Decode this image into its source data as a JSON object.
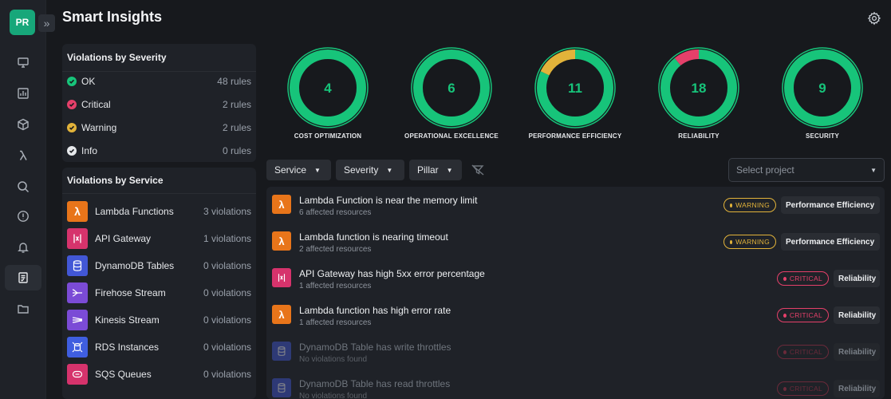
{
  "app": {
    "avatar_initials": "PR",
    "title": "Smart Insights",
    "expand_glyph": "»"
  },
  "nav": [
    {
      "icon": "monitor-icon"
    },
    {
      "icon": "bar-chart-icon"
    },
    {
      "icon": "cube-icon"
    },
    {
      "icon": "lambda-icon"
    },
    {
      "icon": "search-icon"
    },
    {
      "icon": "alert-circle-icon"
    },
    {
      "icon": "bell-icon"
    },
    {
      "icon": "insights-icon",
      "active": true
    },
    {
      "icon": "folder-icon"
    }
  ],
  "severity_panel": {
    "title": "Violations by Severity",
    "rows": [
      {
        "label": "OK",
        "count": "48 rules",
        "color": "#17c47a"
      },
      {
        "label": "Critical",
        "count": "2 rules",
        "color": "#e5406a"
      },
      {
        "label": "Warning",
        "count": "2 rules",
        "color": "#e2b33a"
      },
      {
        "label": "Info",
        "count": "0 rules",
        "color": "#e6e8eb"
      }
    ]
  },
  "service_panel": {
    "title": "Violations by Service",
    "rows": [
      {
        "label": "Lambda Functions",
        "count": "3 violations",
        "color": "#e8751a",
        "icon": "lambda-icon"
      },
      {
        "label": "API Gateway",
        "count": "1 violations",
        "color": "#d6336c",
        "icon": "api-gateway-icon"
      },
      {
        "label": "DynamoDB Tables",
        "count": "0 violations",
        "color": "#4257d6",
        "icon": "dynamodb-icon"
      },
      {
        "label": "Firehose Stream",
        "count": "0 violations",
        "color": "#7b4bd6",
        "icon": "firehose-icon"
      },
      {
        "label": "Kinesis Stream",
        "count": "0 violations",
        "color": "#7b4bd6",
        "icon": "kinesis-icon"
      },
      {
        "label": "RDS Instances",
        "count": "0 violations",
        "color": "#3f5ee0",
        "icon": "rds-icon"
      },
      {
        "label": "SQS Queues",
        "count": "0 violations",
        "color": "#d6336c",
        "icon": "sqs-icon"
      }
    ]
  },
  "pillars": [
    {
      "label": "COST OPTIMIZATION",
      "count": "4",
      "ok_fraction": 1.0,
      "warn_fraction": 0,
      "crit_fraction": 0
    },
    {
      "label": "OPERATIONAL EXCELLENCE",
      "count": "6",
      "ok_fraction": 1.0,
      "warn_fraction": 0,
      "crit_fraction": 0
    },
    {
      "label": "PERFORMANCE EFFICIENCY",
      "count": "11",
      "ok_fraction": 0.82,
      "warn_fraction": 0.18,
      "crit_fraction": 0
    },
    {
      "label": "RELIABILITY",
      "count": "18",
      "ok_fraction": 0.89,
      "warn_fraction": 0,
      "crit_fraction": 0.11
    },
    {
      "label": "SECURITY",
      "count": "9",
      "ok_fraction": 1.0,
      "warn_fraction": 0,
      "crit_fraction": 0
    }
  ],
  "filters": {
    "service": "Service",
    "severity": "Severity",
    "pillar": "Pillar",
    "project_placeholder": "Select project"
  },
  "insights": [
    {
      "title": "Lambda Function is near the memory limit",
      "sub": "6 affected resources",
      "severity": "WARNING",
      "pillar": "Performance Efficiency",
      "icon": "lambda-icon",
      "color": "#e8751a",
      "dim": false
    },
    {
      "title": "Lambda function is nearing timeout",
      "sub": "2 affected resources",
      "severity": "WARNING",
      "pillar": "Performance Efficiency",
      "icon": "lambda-icon",
      "color": "#e8751a",
      "dim": false
    },
    {
      "title": "API Gateway has high 5xx error percentage",
      "sub": "1 affected resources",
      "severity": "CRITICAL",
      "pillar": "Reliability",
      "icon": "api-gateway-icon",
      "color": "#d6336c",
      "dim": false
    },
    {
      "title": "Lambda function has high error rate",
      "sub": "1 affected resources",
      "severity": "CRITICAL",
      "pillar": "Reliability",
      "icon": "lambda-icon",
      "color": "#e8751a",
      "dim": false
    },
    {
      "title": "DynamoDB Table has write throttles",
      "sub": "No violations found",
      "severity": "CRITICAL",
      "pillar": "Reliability",
      "icon": "dynamodb-icon",
      "color": "#4257d6",
      "dim": true
    },
    {
      "title": "DynamoDB Table has read throttles",
      "sub": "No violations found",
      "severity": "CRITICAL",
      "pillar": "Reliability",
      "icon": "dynamodb-icon",
      "color": "#4257d6",
      "dim": true
    }
  ],
  "colors": {
    "ok": "#17c47a",
    "warn": "#e2b33a",
    "crit": "#e5406a"
  }
}
